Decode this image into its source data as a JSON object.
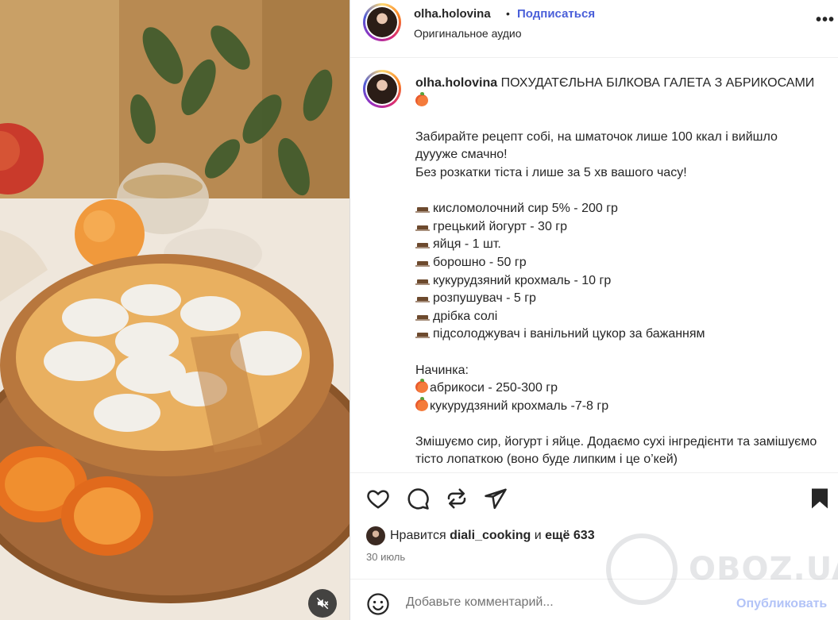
{
  "post": {
    "username": "olha.holovina",
    "follow_label": "Подписаться",
    "audio_label": "Оригинальное аудио",
    "more_label": "•••"
  },
  "caption": {
    "username": "olha.holovina",
    "title": "ПОХУДАТЄЛЬНА БІЛКОВА ГАЛЕТА З АБРИКОСАМИ",
    "intro_1": "Забирайте рецепт собі, на шматочок лише 100 ккал і вийшло дуууже смачно!",
    "intro_2": "Без розкатки тіста і лише за 5 хв вашого часу!",
    "ingredients": [
      "кисломолочний сир 5% - 200 гр",
      "грецький йогурт - 30 гр",
      "яйця - 1 шт.",
      "борошно - 50 гр",
      "кукурудзяний крохмаль - 10 гр",
      "розпушувач - 5 гр",
      "дрібка солі",
      "підсолоджувач і ванільний цукор за бажанням"
    ],
    "filling_title": "Начинка:",
    "filling": [
      "абрикоси - 250-300 гр",
      "кукурудзяний крохмаль -7-8 гр"
    ],
    "steps": "Змішуємо сир, йогурт і яйце. Додаємо сухі інгредієнти та замішуємо тісто лопаткою (воно буде липким і це о’кей)"
  },
  "likes": {
    "prefix": "Нравится",
    "user": "diali_cooking",
    "middle": "и",
    "rest": "ещё 633"
  },
  "date": "30 июль",
  "comment": {
    "placeholder": "Добавьте комментарий...",
    "publish_label": "Опубликовать"
  },
  "watermark": "OBOZ.UA",
  "colors": {
    "link": "#4a5fd9",
    "publish_disabled": "#b2c3f7",
    "text": "#262626",
    "muted": "#737373"
  },
  "icons": [
    "heart-icon",
    "comment-icon",
    "repost-icon",
    "share-icon",
    "bookmark-icon",
    "emoji-icon",
    "mute-icon",
    "more-icon"
  ]
}
